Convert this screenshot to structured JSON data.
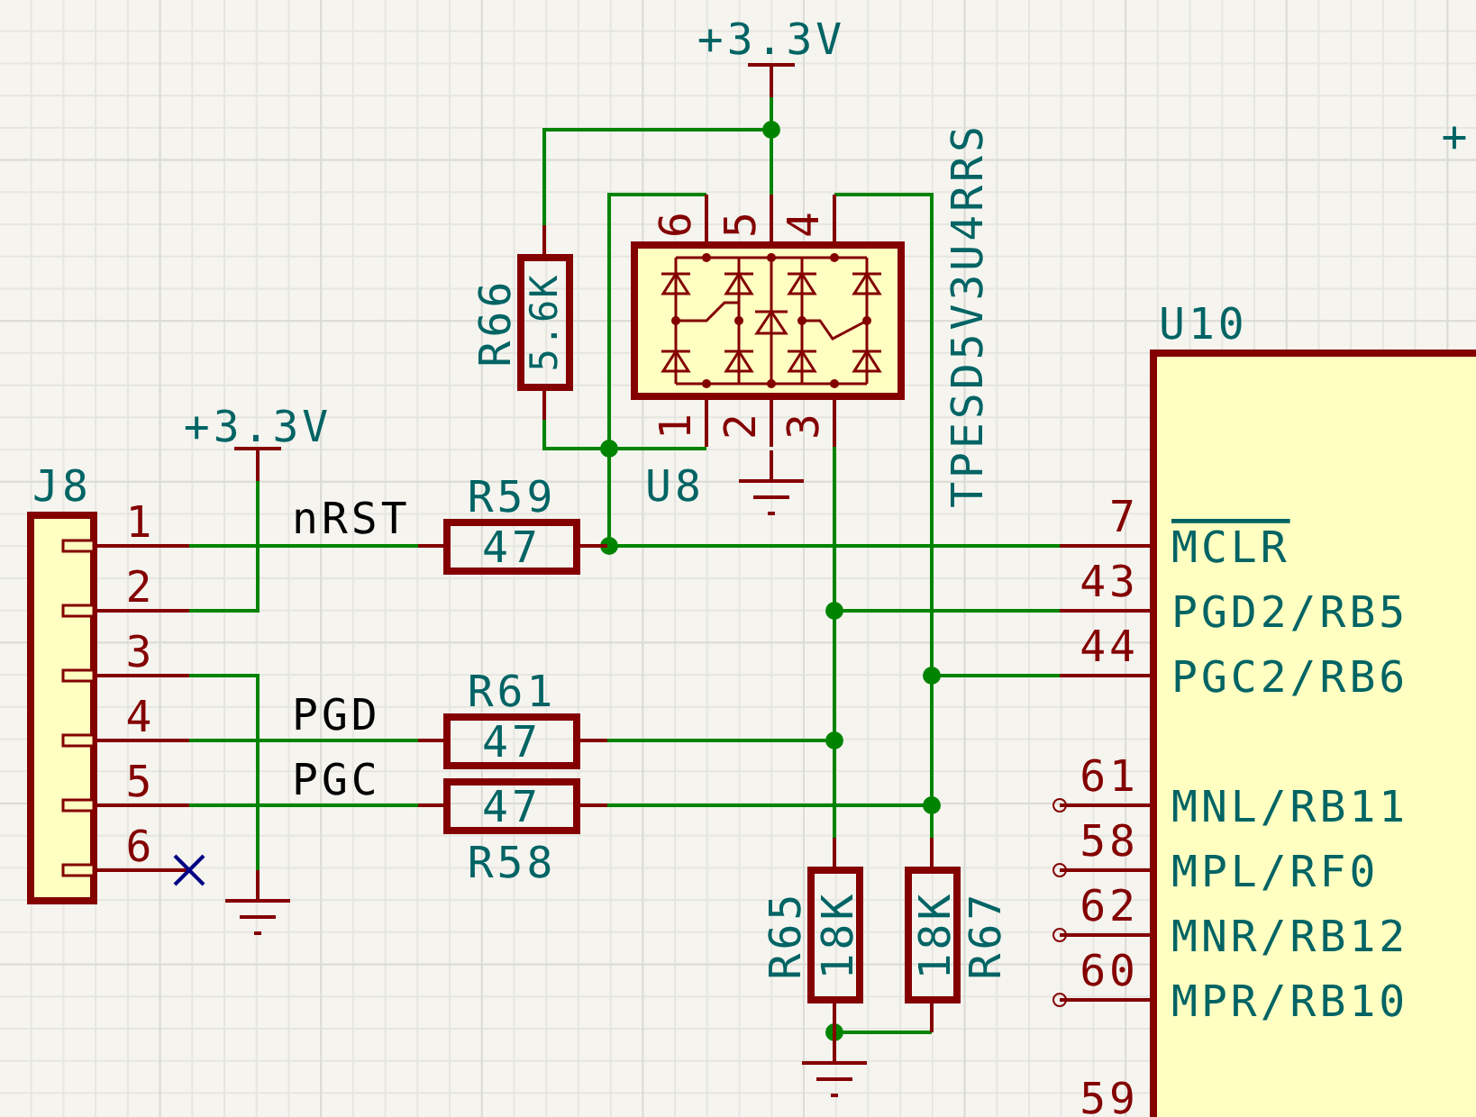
{
  "schematic": {
    "power_ports": [
      {
        "label": "+3.3V"
      },
      {
        "label": "+3.3V"
      },
      {
        "label": "+"
      }
    ],
    "connector": {
      "reference": "J8",
      "pins": [
        {
          "number": "1",
          "no_connect": false
        },
        {
          "number": "2",
          "no_connect": false
        },
        {
          "number": "3",
          "no_connect": false
        },
        {
          "number": "4",
          "no_connect": false
        },
        {
          "number": "5",
          "no_connect": false
        },
        {
          "number": "6",
          "no_connect": true
        }
      ]
    },
    "net_labels": [
      {
        "text": "nRST"
      },
      {
        "text": "PGD"
      },
      {
        "text": "PGC"
      }
    ],
    "resistors": [
      {
        "reference": "R59",
        "value": "47"
      },
      {
        "reference": "R61",
        "value": "47"
      },
      {
        "reference": "R58",
        "value": "47"
      },
      {
        "reference": "R66",
        "value": "5.6K"
      },
      {
        "reference": "R65",
        "value": "18K"
      },
      {
        "reference": "R67",
        "value": "18K"
      }
    ],
    "esd_array": {
      "reference": "U8",
      "value": "TPESD5V3U4RRS",
      "pins": [
        "6",
        "5",
        "4",
        "1",
        "2",
        "3"
      ]
    },
    "mcu": {
      "reference": "U10",
      "pins": [
        {
          "number": "7",
          "name": "MCLR",
          "overline": true,
          "connected": true
        },
        {
          "number": "43",
          "name": "PGD2/RB5",
          "overline": false,
          "connected": true
        },
        {
          "number": "44",
          "name": "PGC2/RB6",
          "overline": false,
          "connected": true
        },
        {
          "number": "61",
          "name": "MNL/RB11",
          "overline": false,
          "connected": false
        },
        {
          "number": "58",
          "name": "MPL/RF0",
          "overline": false,
          "connected": false
        },
        {
          "number": "62",
          "name": "MNR/RB12",
          "overline": false,
          "connected": false
        },
        {
          "number": "60",
          "name": "MPR/RB10",
          "overline": false,
          "connected": false
        },
        {
          "number": "59"
        }
      ]
    }
  }
}
